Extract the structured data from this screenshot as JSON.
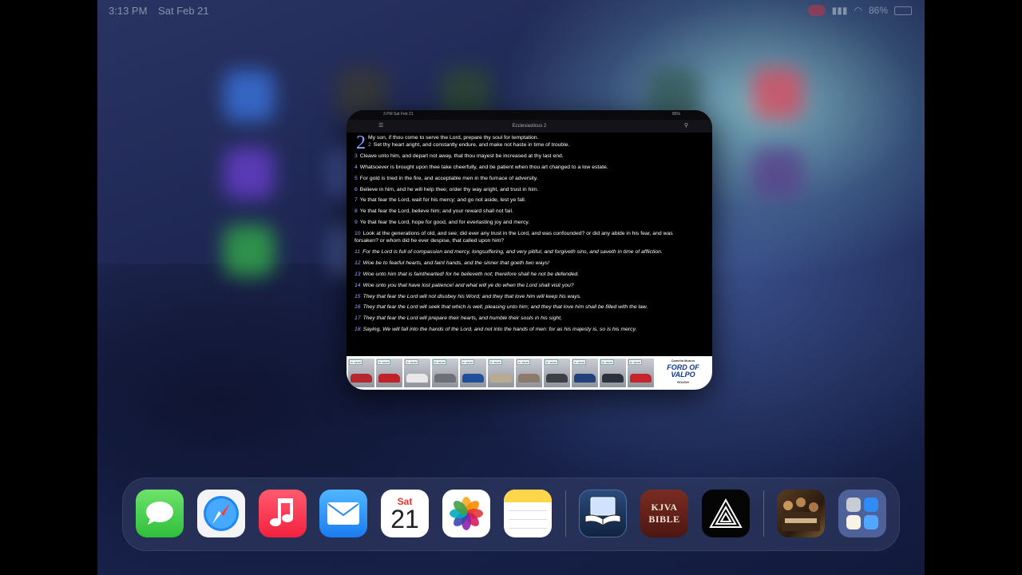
{
  "status_bar": {
    "time": "3:13 PM",
    "date": "Sat Feb 21",
    "battery": "86%"
  },
  "app_card": {
    "status_time": "3 PM  Sat Feb 21",
    "status_battery": "85%",
    "book_title": "Ecclesiasticus 2",
    "chapter_number": "2",
    "verses": [
      {
        "num": "",
        "text": "My son, if thou come to serve the Lord, prepare thy soul for temptation."
      },
      {
        "num": "2",
        "text": "Set thy heart aright, and constantly endure, and make not haste in time of trouble."
      },
      {
        "num": "3",
        "text": "Cleave unto him, and depart not away, that thou mayest be increased at thy last end."
      },
      {
        "num": "4",
        "text": "Whatsoever is brought upon thee take cheerfully, and be patient when thou art changed to a low estate."
      },
      {
        "num": "5",
        "text": "For gold is tried in the fire, and acceptable men in the furnace of adversity."
      },
      {
        "num": "6",
        "text": "Believe in him, and he will help thee; order thy way aright, and trust in him."
      },
      {
        "num": "7",
        "text": "Ye that fear the Lord, wait for his mercy; and go not aside, lest ye fall."
      },
      {
        "num": "8",
        "text": "Ye that fear the Lord, believe him; and your reward shall not fail."
      },
      {
        "num": "9",
        "text": "Ye that fear the Lord, hope for good, and for everlasting joy and mercy."
      },
      {
        "num": "10",
        "text": "Look at the generations of old, and see; did ever any trust in the Lord, and was confounded? or did any abide in his fear, and was forsaken? or whom did he ever despise, that called upon him?"
      },
      {
        "num": "11",
        "text": "For the Lord is full of compassion and mercy, longsuffering, and very pitiful, and forgiveth sins, and saveth in time of affliction."
      },
      {
        "num": "12",
        "text": "Woe be to fearful hearts, and faint hands, and the sinner that goeth two ways!"
      },
      {
        "num": "13",
        "text": "Woe unto him that is fainthearted! for he believeth not; therefore shall he not be defended."
      },
      {
        "num": "14",
        "text": "Woe unto you that have lost patience! and what will ye do when the Lord shall visit you?"
      },
      {
        "num": "15",
        "text": "They that fear the Lord will not disobey his Word; and they that love him will keep his ways."
      },
      {
        "num": "16",
        "text": "They that fear the Lord will seek that which is well, pleasing unto him; and they that love him shall be filled with the law."
      },
      {
        "num": "17",
        "text": "They that fear the Lord will prepare their hearts, and humble their souls in his sight,"
      },
      {
        "num": "18",
        "text": "Saying, We will fall into the hands of the Lord, and not into the hands of men: for as his majesty is, so is his mercy."
      }
    ],
    "ad": {
      "tag": "In store",
      "car_colors": [
        "#b3272d",
        "#c0202a",
        "#e8e8e8",
        "#6d7078",
        "#1f4f9a",
        "#b8ab94",
        "#8c7a6a",
        "#3b3f46",
        "#22407a",
        "#2c3140",
        "#c4242c"
      ],
      "dealer_top": "Camelia Motors",
      "dealer_name": "FORD OF VALPO",
      "dealer_sub": "ROUSH"
    }
  },
  "dock": {
    "calendar_day": "Sat",
    "calendar_date": "21",
    "kjva_line1": "KJVA",
    "kjva_line2": "BIBLE",
    "apps": [
      "Messages",
      "Safari",
      "Music",
      "Mail",
      "Calendar",
      "Photos",
      "Notes",
      "Bible Study",
      "KJVA Bible",
      "Prism",
      "Recent Photo",
      "App Library"
    ]
  }
}
